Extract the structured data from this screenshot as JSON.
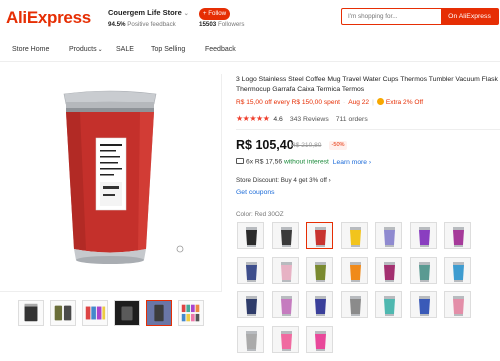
{
  "header": {
    "logo": "AliExpress",
    "store_name": "Couergem Life Store",
    "feedback_pct": "94.5%",
    "feedback_label": "Positive feedback",
    "follow_label": "+ Follow",
    "followers_count": "15503",
    "followers_label": "Followers",
    "search_placeholder": "I'm shopping for...",
    "search_button": "On AliExpress"
  },
  "nav": {
    "items": [
      "Store Home",
      "Products",
      "SALE",
      "Top Selling",
      "Feedback"
    ]
  },
  "product": {
    "title": "3 Logo Stainless Steel Coffee Mug Travel Water Cups Thermos Tumbler Vacuum Flask Thermocup Garrafa Caixa Termica Termos",
    "promo_spend": "R$ 15,00 off every R$ 150,00 spent",
    "promo_date": "Aug 22",
    "promo_extra": "Extra 2% Off",
    "rating_value": "4.6",
    "stars": "★★★★★",
    "reviews": "343 Reviews",
    "orders": "711 orders",
    "price": "R$ 105,40",
    "old_price": "R$ 210,80",
    "discount": "-50%",
    "installment_prefix": "6x R$ 17,56",
    "installment_interest": "without interest",
    "learn_more": "Learn more",
    "learn_more_chevron": "›",
    "store_discount": "Store Discount: Buy 4 get 3% off",
    "coupons": "Get coupons",
    "color_label": "Color:",
    "color_value": "Red 30OZ"
  },
  "swatches": [
    {
      "color": "#2b2b2b"
    },
    {
      "color": "#3a3a3a"
    },
    {
      "color": "#c8332f"
    },
    {
      "color": "#f2c41c"
    },
    {
      "color": "#8f8ad0"
    },
    {
      "color": "#8a3ec0"
    },
    {
      "color": "#a63a9a"
    },
    {
      "color": "#3e4e8c"
    },
    {
      "color": "#e7b2c4"
    },
    {
      "color": "#7a8a30"
    },
    {
      "color": "#f08a1a"
    },
    {
      "color": "#a33070"
    },
    {
      "color": "#5a9a92"
    },
    {
      "color": "#3e9cd0"
    },
    {
      "color": "#2f3c6a"
    },
    {
      "color": "#c57bbf"
    },
    {
      "color": "#3a3f9a"
    },
    {
      "color": "#8b8b8b"
    },
    {
      "color": "#4fb8b0"
    },
    {
      "color": "#3a5ab8"
    },
    {
      "color": "#e38ea8"
    },
    {
      "color": "#aaaaaa"
    },
    {
      "color": "#f06aa0"
    },
    {
      "color": "#e8489a"
    }
  ],
  "colors": {
    "brand": "#e62e04",
    "link": "#1a6ad8",
    "green": "#1a8a3a"
  }
}
